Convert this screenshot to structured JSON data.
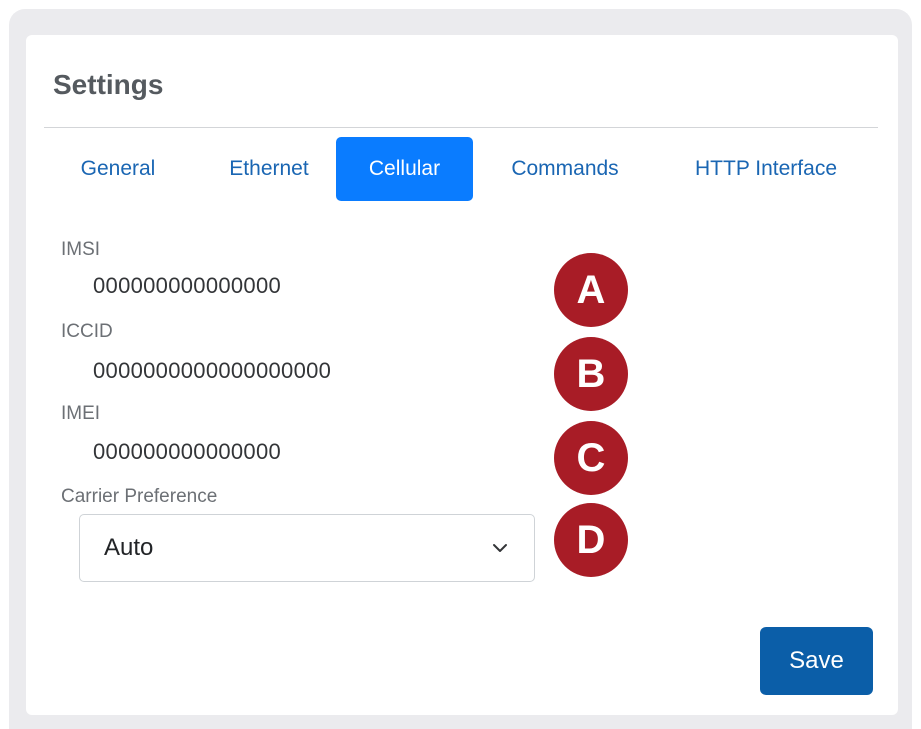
{
  "settings": {
    "title": "Settings"
  },
  "tabs": [
    {
      "label": "General",
      "active": false
    },
    {
      "label": "Ethernet",
      "active": false
    },
    {
      "label": "Cellular",
      "active": true
    },
    {
      "label": "Commands",
      "active": false
    },
    {
      "label": "HTTP Interface",
      "active": false
    }
  ],
  "cellular": {
    "imsi_label": "IMSI",
    "imsi_value": "000000000000000",
    "iccid_label": "ICCID",
    "iccid_value": "0000000000000000000",
    "imei_label": "IMEI",
    "imei_value": "000000000000000",
    "carrier_label": "Carrier Preference",
    "carrier_value": "Auto"
  },
  "callouts": [
    "A",
    "B",
    "C",
    "D"
  ],
  "actions": {
    "save_label": "Save"
  },
  "colors": {
    "active_tab": "#0a7cff",
    "tab_text": "#1a66b3",
    "save_button": "#0b5ea8",
    "callout_badge": "#a81c26"
  },
  "icons": {
    "carrier_dropdown": "chevron-down-icon"
  }
}
